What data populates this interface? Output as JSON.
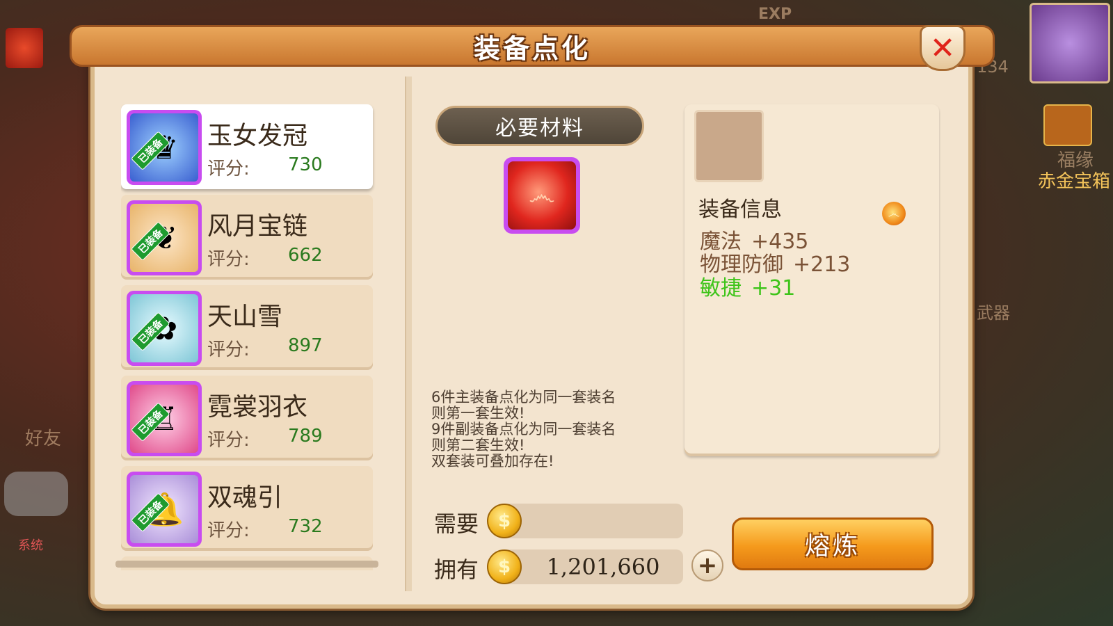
{
  "dialog": {
    "title": "装备点化",
    "close_glyph": "✕"
  },
  "equipment_list": {
    "equipped_tag": "已装备",
    "score_label": "评分:",
    "items": [
      {
        "name": "玉女发冠",
        "score": "730",
        "icon": "crown-icon",
        "selected": true
      },
      {
        "name": "风月宝链",
        "score": "662",
        "icon": "necklace-icon",
        "selected": false
      },
      {
        "name": "天山雪",
        "score": "897",
        "icon": "flower-icon",
        "selected": false
      },
      {
        "name": "霓裳羽衣",
        "score": "789",
        "icon": "robe-icon",
        "selected": false
      },
      {
        "name": "双魂引",
        "score": "732",
        "icon": "bell-icon",
        "selected": false
      }
    ]
  },
  "materials": {
    "title": "必要材料",
    "item_icon": "red-orb-icon"
  },
  "description": [
    "6件主装备点化为同一套装名",
    "则第一套生效!",
    "9件副装备点化为同一套装名",
    "则第二套生效!",
    "双套装可叠加存在!"
  ],
  "cost": {
    "need_label": "需要",
    "need_value": "",
    "have_label": "拥有",
    "have_value": "1,201,660",
    "plus_glyph": "+"
  },
  "info_panel": {
    "title": "装备信息",
    "stats": [
      {
        "name": "魔法",
        "value": "+435",
        "color": "#7a5236"
      },
      {
        "name": "物理防御",
        "value": "+213",
        "color": "#7a5236"
      },
      {
        "name": "敏捷",
        "value": "+31",
        "color": "#3ec41a"
      }
    ]
  },
  "smelt_button": {
    "label": "熔炼"
  },
  "background": {
    "friend_label": "好友",
    "chest_label": "赤金宝箱",
    "destiny_label": "福缘",
    "weapon_label": "武器",
    "level_text": "134",
    "exp_label": "EXP",
    "system_tag": "系统"
  }
}
